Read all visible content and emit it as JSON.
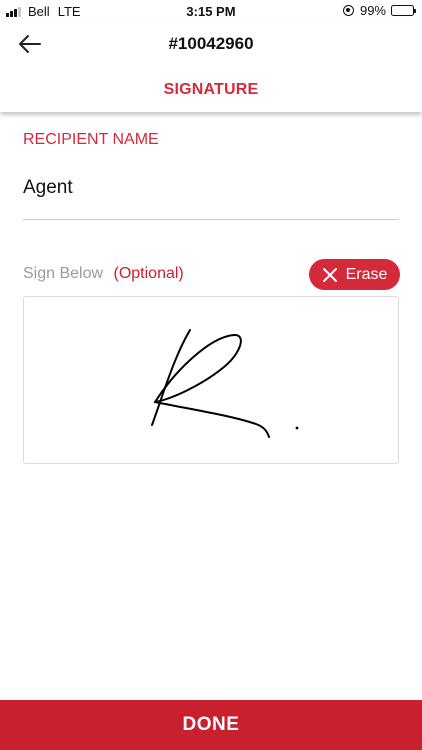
{
  "status_bar": {
    "carrier": "Bell",
    "network": "LTE",
    "time": "3:15 PM",
    "battery": "99%",
    "icons": [
      "signal-icon",
      "orientation-lock-icon",
      "battery-icon"
    ]
  },
  "nav": {
    "back_icon": "back-arrow-icon",
    "title": "#10042960",
    "subtitle": "SIGNATURE"
  },
  "form": {
    "recipient_label": "RECIPIENT NAME",
    "recipient_value": "Agent",
    "sign_label": "Sign Below",
    "sign_optional": "(Optional)",
    "erase_label": "Erase",
    "erase_icon": "close-icon",
    "signature_image": "handwritten-signature"
  },
  "footer": {
    "done_label": "DONE"
  },
  "colors": {
    "accent": "#d42a3a",
    "done_background": "#c8202e",
    "muted_text": "#9a9a9a"
  }
}
